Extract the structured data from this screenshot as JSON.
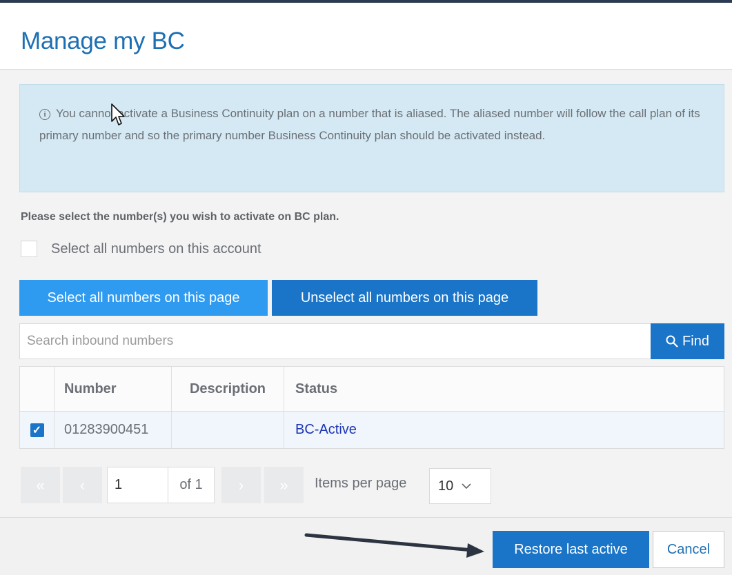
{
  "dialog": {
    "title": "Manage my BC"
  },
  "info": {
    "icon": "info-circle-icon",
    "text": "You cannot activate a Business Continuity plan on a number that is aliased. The aliased number will follow the call plan of its primary number and so the primary number Business Continuity plan should be activated instead."
  },
  "selection": {
    "prompt": "Please select the number(s) you wish to activate on BC plan.",
    "select_all_account_label": "Select all numbers on this account",
    "select_all_account_checked": false
  },
  "buttons": {
    "select_page": "Select all numbers on this page",
    "unselect_page": "Unselect all numbers on this page"
  },
  "search": {
    "placeholder": "Search inbound numbers",
    "value": "",
    "find_label": "Find",
    "find_icon": "search-icon"
  },
  "table": {
    "columns": [
      "",
      "Number",
      "Description",
      "Status"
    ],
    "rows": [
      {
        "checked": true,
        "number": "01283900451",
        "description": "",
        "status": "BC-Active"
      }
    ]
  },
  "pagination": {
    "first_icon": "double-chevron-left-icon",
    "prev_icon": "chevron-left-icon",
    "next_icon": "chevron-right-icon",
    "last_icon": "double-chevron-right-icon",
    "current_page": "1",
    "of_text": "of 1",
    "items_per_page_label": "Items per page",
    "items_per_page_value": "10"
  },
  "footer": {
    "restore_label": "Restore last active",
    "cancel_label": "Cancel"
  },
  "colors": {
    "title": "#1d6fb3",
    "primary_button": "#1a74c7",
    "light_button": "#2e9af0",
    "info_background": "#d4e9f4",
    "status_link": "#1d35b5"
  }
}
